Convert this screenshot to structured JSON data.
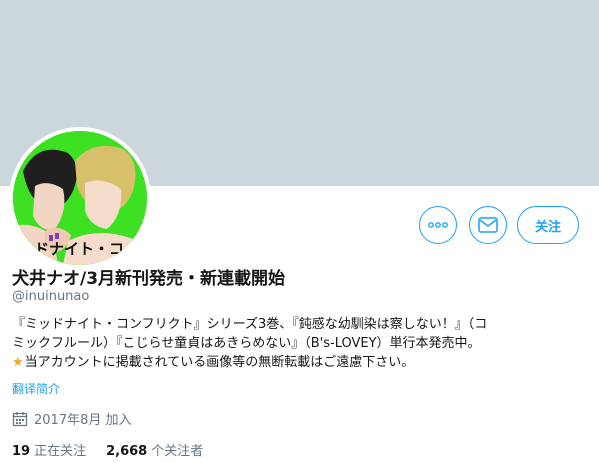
{
  "profile": {
    "name": "犬井ナオ/3月新刊発売・新連載開始",
    "handle": "@inuinunao",
    "bio_lines": [
      "『ミッドナイト・コンフリクト』シリーズ3巻、『鈍感な幼馴染は察しない！』（コ",
      "ミックフルール）『こじらせ童貞はあきらめない』（B's-LOVEY）単行本発売中。",
      "当アカウントに掲載されている画像等の無断転載はご遠慮下さい。"
    ],
    "translate_label": "翻译简介",
    "joined": "2017年8月 加入",
    "following_count": "19",
    "following_label": "正在关注",
    "followers_count": "2,668",
    "followers_label": "个关注者"
  },
  "actions": {
    "more_icon": "more-icon",
    "message_icon": "envelope-icon",
    "follow_label": "关注"
  },
  "avatar_text": "ッドナイト・コ",
  "colors": {
    "accent": "#1da1f2",
    "banner": "#ccd6dd",
    "avatar_bg": "#3ee022",
    "star": "#f5a623"
  }
}
